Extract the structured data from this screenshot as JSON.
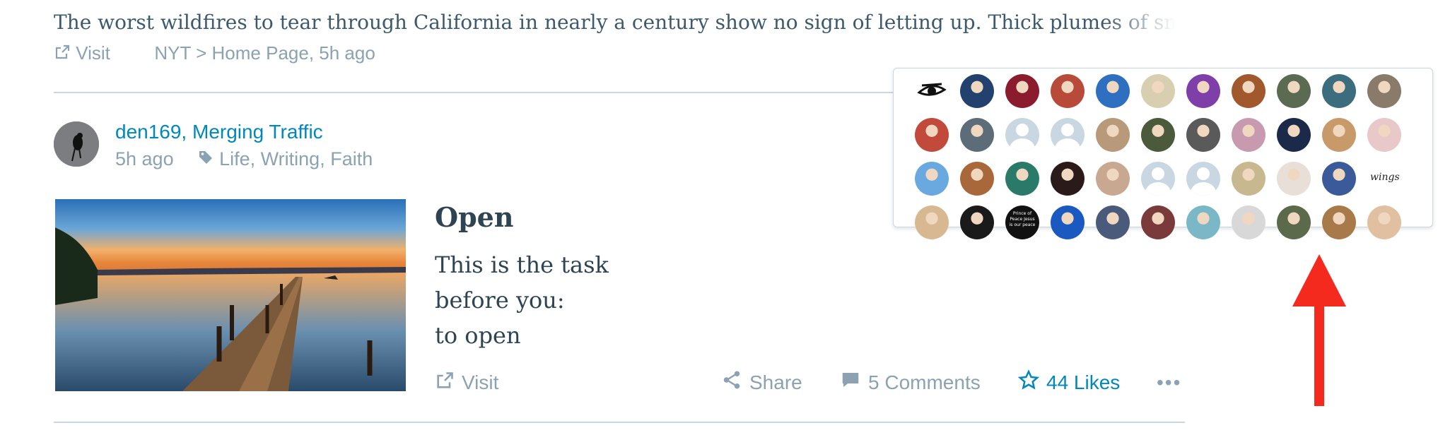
{
  "prev_post": {
    "excerpt": "The worst wildfires to tear through California in nearly a century show no sign of letting up. Thick plumes of sm",
    "visit_label": "Visit",
    "source": "NYT > Home Page, 5h ago"
  },
  "post": {
    "author_line": "den169, Merging Traffic",
    "time": "5h ago",
    "tags": "Life, Writing, Faith",
    "title": "Open",
    "body_line1": "This is the task",
    "body_line2": "before you:",
    "body_line3": "to open",
    "visit_label": "Visit",
    "share_label": "Share",
    "comments_label": "5 Comments",
    "likes_label": "44 Likes",
    "more_label": "•••"
  },
  "likers_popover": {
    "avatars": [
      "#ffffff",
      "#23416e",
      "#8a1c2e",
      "#b84a3a",
      "#2f6fbf",
      "#d8cfb0",
      "#7e3fa8",
      "#a0582c",
      "#5a6b52",
      "#3b6d7f",
      "#8a7a6a",
      "#c24a3a",
      "#5c6c78",
      "default",
      "default",
      "#b89a7a",
      "#4a5a3a",
      "#5a5a5a",
      "#c89ab0",
      "#1c2a4a",
      "#c89a6a",
      "#e8c8c8",
      "#6aa8e0",
      "#a8683a",
      "#2a7a6a",
      "#2a1a1a",
      "#c8a890",
      "default",
      "default",
      "#c8b890",
      "#e8e0d8",
      "#3a5a9a",
      "#ffffff",
      "#d8b890",
      "#1a1a1a",
      "#111111",
      "#1a5ac0",
      "#4a5a7a",
      "#7a3a3a",
      "#7ab8c8",
      "#d8d8d8",
      "#5a6a4a",
      "#a87a4a",
      "#e0c0a0"
    ],
    "avatar_texts": {
      "wings": "wings",
      "prince": "Prince of Peace Jesus is our peace"
    }
  }
}
